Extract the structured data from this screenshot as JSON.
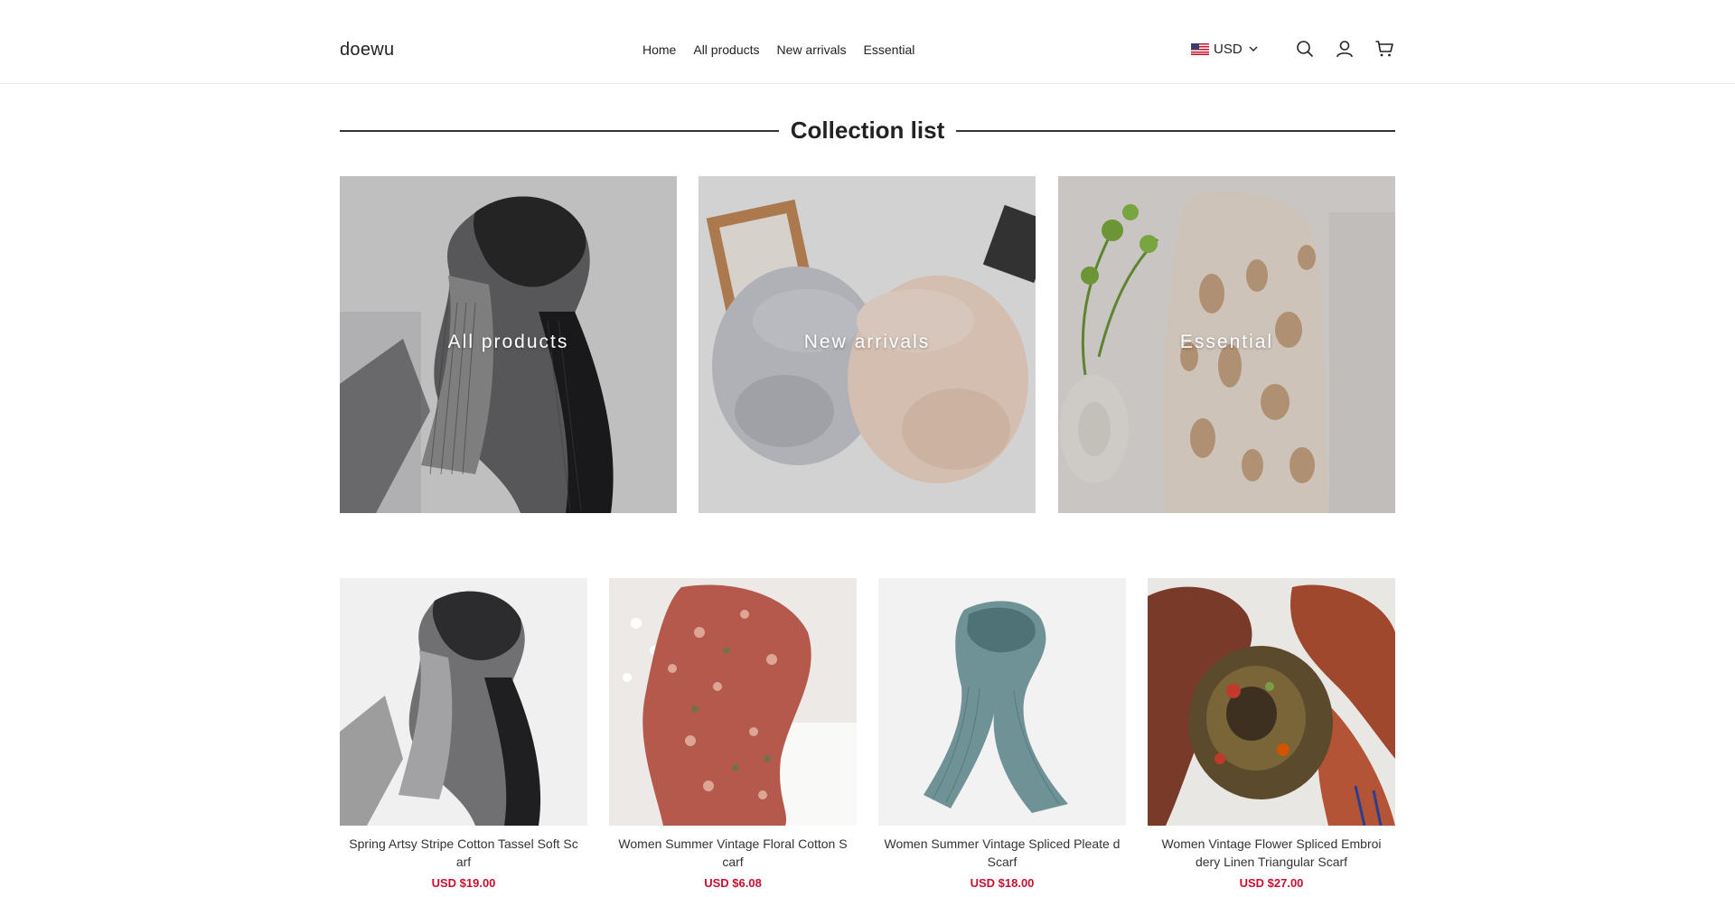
{
  "header": {
    "logo": "doewu",
    "nav": [
      "Home",
      "All products",
      "New arrivals",
      "Essential"
    ],
    "currency": "USD",
    "icons": [
      "us-flag-icon",
      "chevron-down-icon",
      "search-icon",
      "account-icon",
      "cart-icon"
    ]
  },
  "collection_list": {
    "title": "Collection list",
    "tiles": [
      {
        "label": "All products"
      },
      {
        "label": "New arrivals"
      },
      {
        "label": "Essential"
      }
    ]
  },
  "products": [
    {
      "title": "Spring Artsy Stripe Cotton Tassel Soft Sc arf",
      "price": "USD $19.00"
    },
    {
      "title": "Women Summer Vintage Floral Cotton S carf",
      "price": "USD $6.08"
    },
    {
      "title": "Women Summer Vintage Spliced Pleate d Scarf",
      "price": "USD $18.00"
    },
    {
      "title": "Women Vintage Flower Spliced Embroi dery Linen Triangular Scarf",
      "price": "USD $27.00"
    }
  ],
  "colors": {
    "price": "#c8102e",
    "text": "#222222",
    "divider": "#ececec"
  }
}
